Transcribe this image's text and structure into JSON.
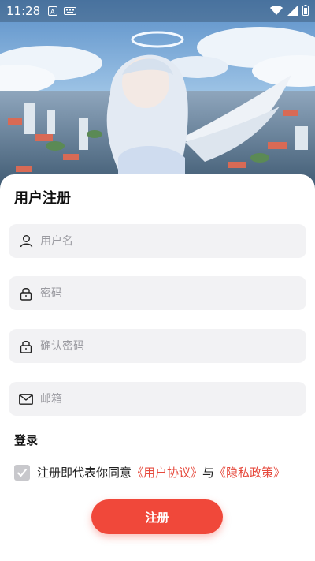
{
  "status_bar": {
    "time": "11:28",
    "icons": [
      "keyboard-a-icon",
      "keyboard-icon",
      "wifi-icon",
      "signal-icon",
      "battery-icon"
    ]
  },
  "register": {
    "title": "用户注册",
    "fields": [
      {
        "icon": "user-icon",
        "placeholder": "用户名",
        "value": ""
      },
      {
        "icon": "lock-icon",
        "placeholder": "密码",
        "value": ""
      },
      {
        "icon": "lock-icon",
        "placeholder": "确认密码",
        "value": ""
      },
      {
        "icon": "mail-icon",
        "placeholder": "邮箱",
        "value": ""
      }
    ],
    "login_link": "登录",
    "agreement": {
      "checked": true,
      "prefix": "注册即代表你同意",
      "user_agreement": "《用户协议》",
      "conjunction": "与",
      "privacy_policy": "《隐私政策》"
    },
    "submit_label": "注册"
  },
  "colors": {
    "accent": "#f0483a",
    "link": "#e64a3d",
    "field_bg": "#f2f2f4"
  }
}
